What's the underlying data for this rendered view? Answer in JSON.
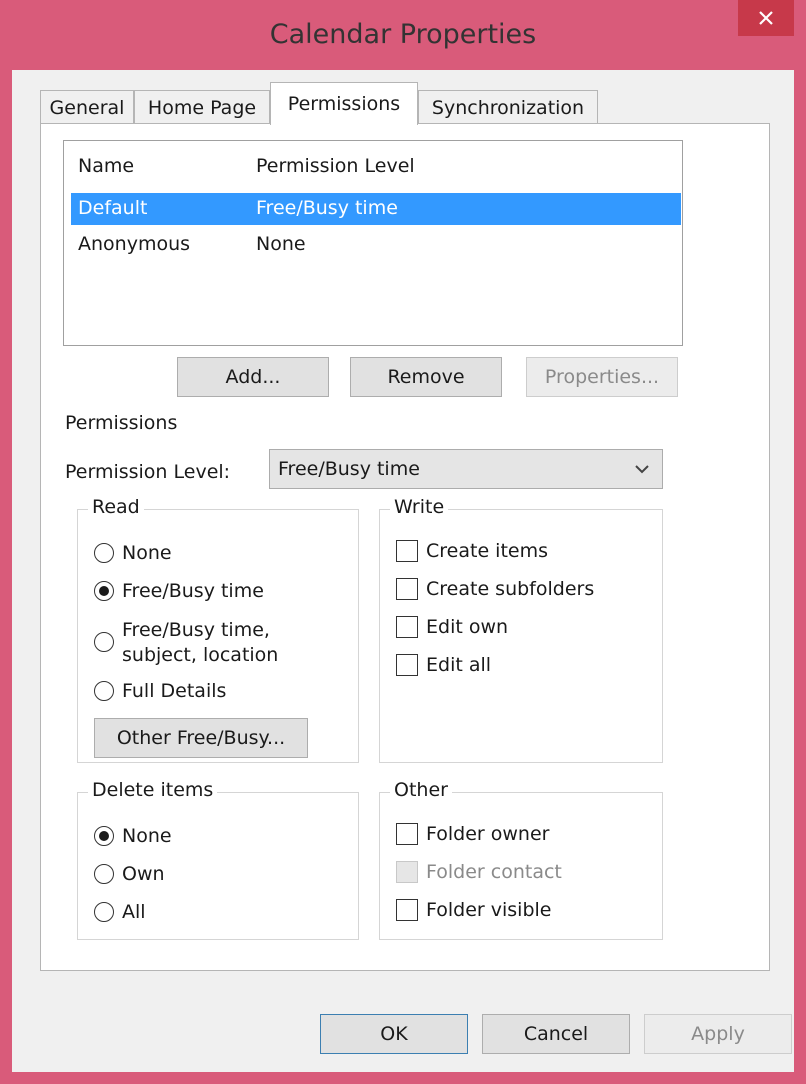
{
  "window": {
    "title": "Calendar Properties",
    "close_icon": "close-icon"
  },
  "tabs": [
    {
      "label": "General",
      "active": false
    },
    {
      "label": "Home Page",
      "active": false
    },
    {
      "label": "Permissions",
      "active": true
    },
    {
      "label": "Synchronization",
      "active": false
    }
  ],
  "permissions_list": {
    "columns": [
      "Name",
      "Permission Level"
    ],
    "rows": [
      {
        "name": "Default",
        "level": "Free/Busy time",
        "selected": true
      },
      {
        "name": "Anonymous",
        "level": "None",
        "selected": false
      }
    ]
  },
  "list_buttons": {
    "add": "Add...",
    "remove": "Remove",
    "properties": "Properties..."
  },
  "permissions_group": {
    "label": "Permissions",
    "level_label": "Permission Level:",
    "level_value": "Free/Busy time"
  },
  "read": {
    "label": "Read",
    "options": [
      "None",
      "Free/Busy time",
      "Free/Busy time,",
      "subject, location",
      "Full Details"
    ],
    "selected": "Free/Busy time",
    "other_button": "Other Free/Busy..."
  },
  "write": {
    "label": "Write",
    "options": [
      "Create items",
      "Create subfolders",
      "Edit own",
      "Edit all"
    ]
  },
  "delete_items": {
    "label": "Delete items",
    "options": [
      "None",
      "Own",
      "All"
    ],
    "selected": "None"
  },
  "other": {
    "label": "Other",
    "options": [
      "Folder owner",
      "Folder contact",
      "Folder visible"
    ],
    "disabled": "Folder contact"
  },
  "footer": {
    "ok": "OK",
    "cancel": "Cancel",
    "apply": "Apply"
  },
  "colors": {
    "title_bar": "#d95b7a",
    "close_button": "#c7394a",
    "selection": "#3399ff"
  }
}
